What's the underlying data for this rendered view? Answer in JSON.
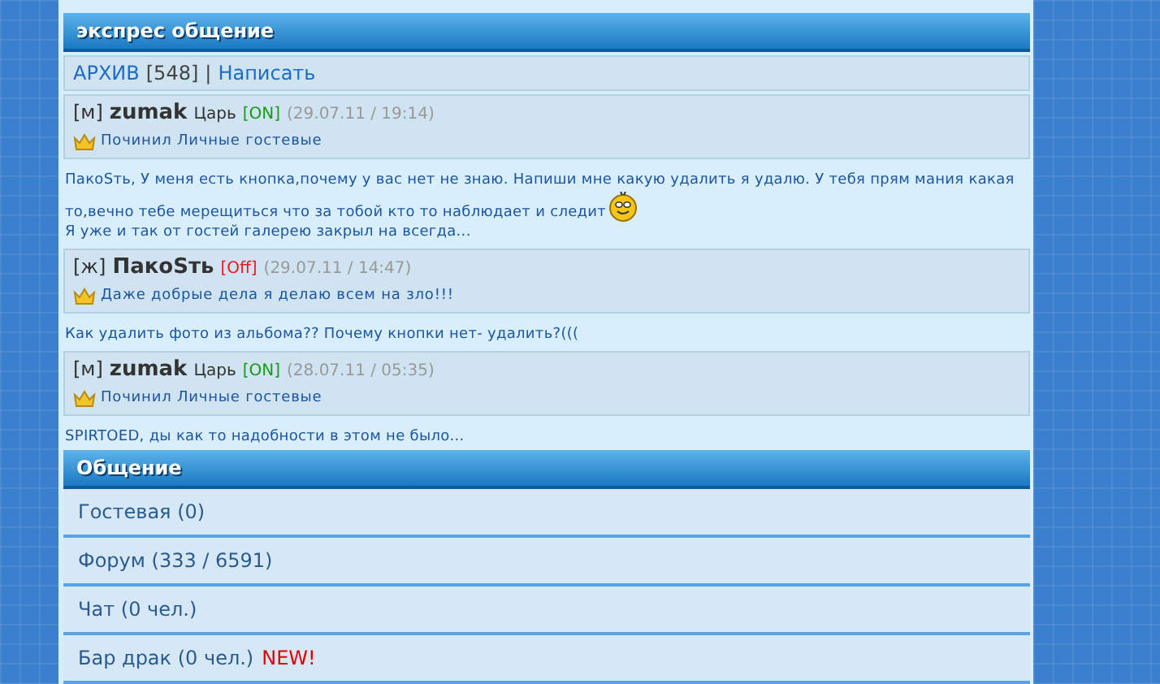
{
  "express": {
    "title": "экспрес общение",
    "archive_link": "АРХИВ",
    "archive_count": "[548]",
    "separator": "|",
    "write_link": "Написать",
    "feed": [
      {
        "kind": "post",
        "gender": "[м]",
        "name": "zumak",
        "rank": "Царь",
        "online": true,
        "status": "[ON]",
        "date": "(29.07.11 / 19:14)",
        "motto": "Починил Личные гостевые"
      },
      {
        "kind": "message",
        "paragraphs": [
          {
            "text": "ПакоSть, У меня есть кнопка,почему у вас нет не знаю. Напиши мне какую удалить я удалю. У тебя прям мания какая"
          },
          {
            "text": "то,вечно тебе мерещиться что за тобой кто то наблюдает и следит",
            "emoticon": true
          },
          {
            "text": "Я уже и так от гостей галерею закрыл на всегда..."
          }
        ]
      },
      {
        "kind": "post",
        "gender": "[ж]",
        "name": "ПакоSть",
        "online": false,
        "status": "[Off]",
        "date": "(29.07.11 / 14:47)",
        "motto": "Даже добрые дела я делаю всем на зло!!!"
      },
      {
        "kind": "message",
        "paragraphs": [
          {
            "text": "Как удалить фото из альбома?? Почему кнопки нет- удалить?((("
          }
        ]
      },
      {
        "kind": "post",
        "gender": "[м]",
        "name": "zumak",
        "rank": "Царь",
        "online": true,
        "status": "[ON]",
        "date": "(28.07.11 / 05:35)",
        "motto": "Починил Личные гостевые"
      },
      {
        "kind": "message",
        "paragraphs": [
          {
            "text": "SPIRTOED, ды как то надобности в этом не было..."
          }
        ]
      }
    ]
  },
  "communication": {
    "title": "Общение",
    "items": [
      {
        "label": "Гостевая (0)"
      },
      {
        "label": "Форум (333 / 6591)"
      },
      {
        "label": "Чат (0 чел.)"
      },
      {
        "label": "Бар драк (0 чел.)",
        "badge": "NEW!"
      }
    ]
  }
}
